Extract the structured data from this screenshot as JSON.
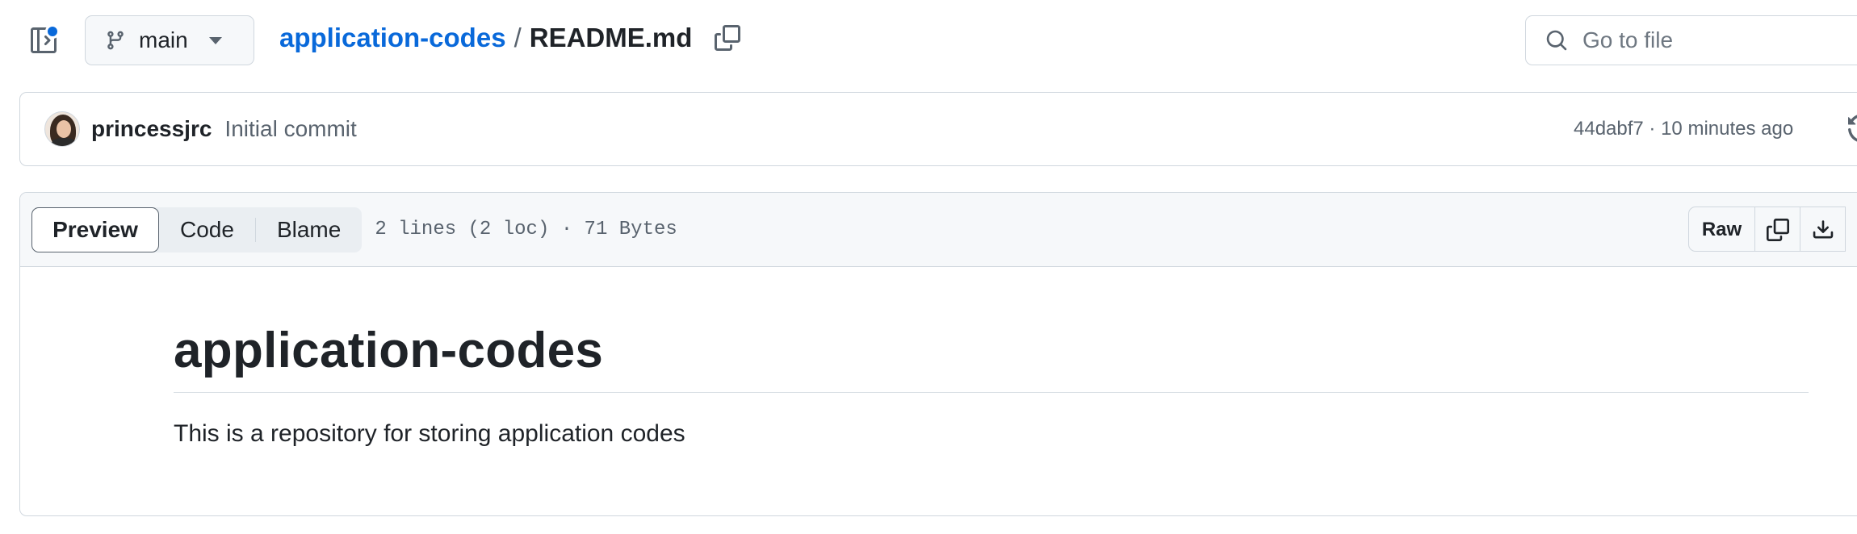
{
  "icons": {
    "sidebar_toggle": "sidebar-panel-icon",
    "branch": "git-branch-icon",
    "copy_path": "copy-icon",
    "search": "search-icon",
    "history": "history-icon",
    "copy_raw": "copy-icon",
    "download": "download-icon"
  },
  "colors": {
    "link": "#0969da",
    "muted": "#59636e",
    "border": "#d0d7de",
    "header_bg": "#f6f8fa",
    "notification": "#0969da"
  },
  "branch": {
    "label": "main"
  },
  "breadcrumb": {
    "repo": "application-codes",
    "separator": "/",
    "file": "README.md"
  },
  "search": {
    "placeholder": "Go to file",
    "value": ""
  },
  "commit": {
    "author": "princessjrc",
    "message": "Initial commit",
    "meta": "44dabf7 · 10 minutes ago"
  },
  "file_view": {
    "tabs": [
      {
        "label": "Preview",
        "active": true
      },
      {
        "label": "Code",
        "active": false
      },
      {
        "label": "Blame",
        "active": false
      }
    ],
    "info": "2 lines (2 loc) · 71 Bytes",
    "raw_label": "Raw"
  },
  "readme": {
    "heading": "application-codes",
    "body": "This is a repository for storing application codes"
  }
}
